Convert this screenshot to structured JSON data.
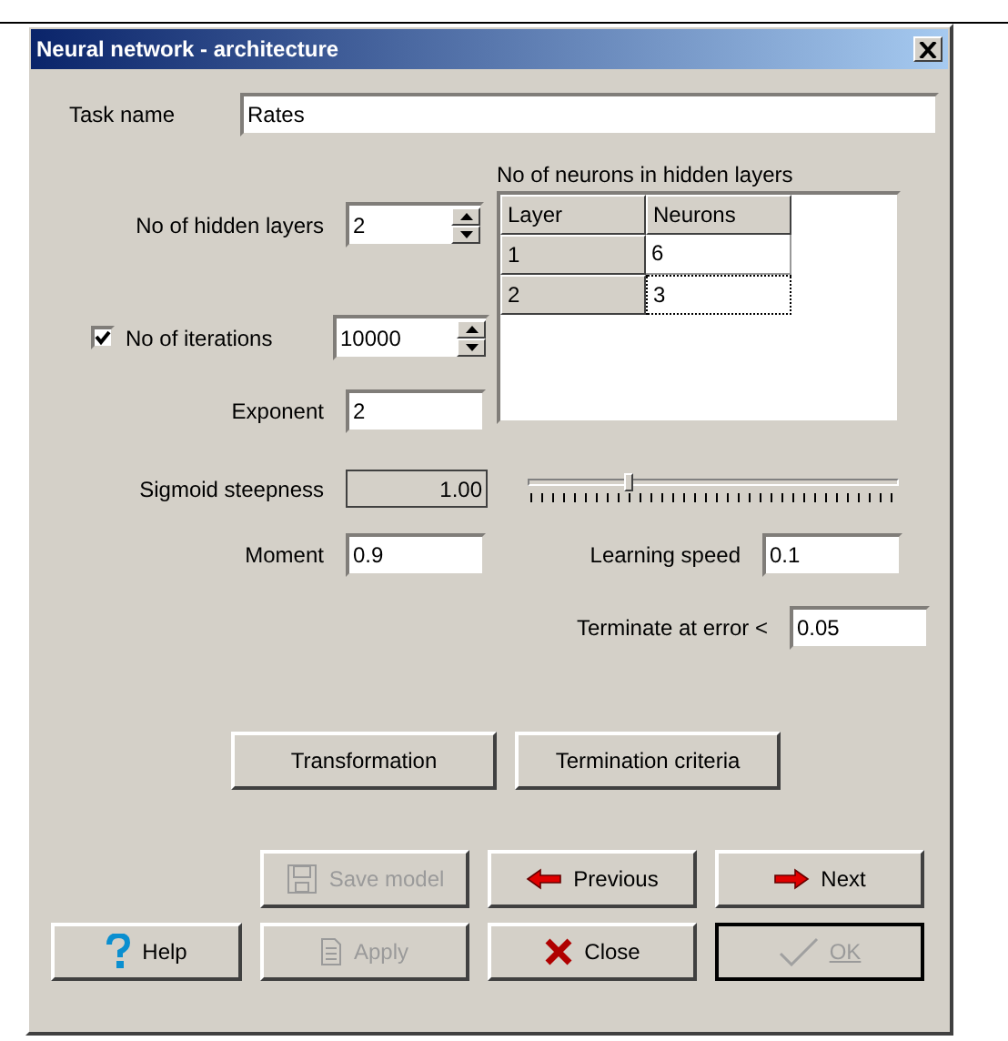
{
  "window": {
    "title": "Neural network - architecture"
  },
  "task_name": {
    "label": "Task name",
    "value": "Rates"
  },
  "hidden_layers": {
    "label": "No of hidden layers",
    "value": "2"
  },
  "iterations": {
    "label": "No of iterations",
    "checked": true,
    "value": "10000"
  },
  "exponent": {
    "label": "Exponent",
    "value": "2"
  },
  "neurons_table": {
    "title": "No of neurons in hidden layers",
    "columns": [
      "Layer",
      "Neurons"
    ],
    "rows": [
      {
        "layer": "1",
        "neurons": "6",
        "selected": false
      },
      {
        "layer": "2",
        "neurons": "3",
        "selected": true
      }
    ]
  },
  "sigmoid": {
    "label": "Sigmoid steepness",
    "reading": "1.00",
    "level": 0.26
  },
  "moment": {
    "label": "Moment",
    "value": "0.9"
  },
  "learning_speed": {
    "label": "Learning speed",
    "value": "0.1"
  },
  "terminate": {
    "label": "Terminate at error <",
    "value": "0.05"
  },
  "middle_buttons": [
    {
      "label": "Transformation"
    },
    {
      "label": "Termination criteria"
    }
  ],
  "nav_buttons": [
    {
      "label": "Save model",
      "kind": "save",
      "disabled": true
    },
    {
      "label": "Previous",
      "kind": "previous",
      "disabled": false
    },
    {
      "label": "Next",
      "kind": "next",
      "disabled": false
    }
  ],
  "bottom_buttons": [
    {
      "label": "Help",
      "kind": "help",
      "disabled": false
    },
    {
      "label": "Apply",
      "kind": "apply",
      "disabled": true
    },
    {
      "label": "Close",
      "kind": "close",
      "disabled": false
    },
    {
      "label": "OK",
      "kind": "ok",
      "disabled": true
    }
  ]
}
